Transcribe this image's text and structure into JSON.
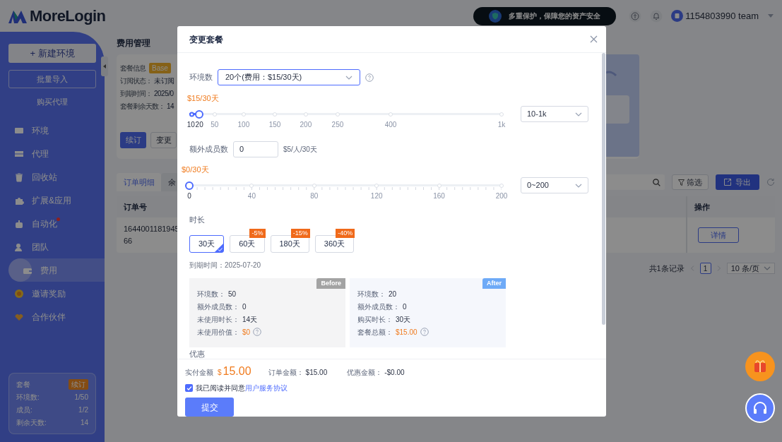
{
  "header": {
    "logo": "MoreLogin",
    "banner": "多重保护，保障您的资产安全",
    "account": "1154803990 team"
  },
  "sidebar": {
    "new_button": "+ 新建环境",
    "import_button": "批量导入",
    "proxy_link": "购买代理",
    "items": [
      {
        "label": "环境",
        "selected": false,
        "dot": false
      },
      {
        "label": "代理",
        "selected": false,
        "dot": false
      },
      {
        "label": "回收站",
        "selected": false,
        "dot": false
      },
      {
        "label": "扩展&应用",
        "selected": false,
        "dot": false
      },
      {
        "label": "自动化",
        "selected": false,
        "dot": true
      },
      {
        "label": "团队",
        "selected": false,
        "dot": false
      },
      {
        "label": "费用",
        "selected": true,
        "dot": false
      },
      {
        "label": "邀请奖励",
        "selected": false,
        "dot": false
      },
      {
        "label": "合作伙伴",
        "selected": false,
        "dot": false
      }
    ],
    "plan_card": {
      "title": "套餐",
      "renew": "续订",
      "rows": [
        {
          "label": "环境数:",
          "value": "1/50"
        },
        {
          "label": "成员:",
          "value": "1/2"
        },
        {
          "label": "剩余天数:",
          "value": "14"
        }
      ]
    }
  },
  "page": {
    "title": "费用管理",
    "plan": {
      "title": "套餐信息",
      "badge": "Base",
      "rows": [
        {
          "label": "订阅状态：",
          "value": "未订阅"
        },
        {
          "label": "到期时间：",
          "value": "2025/0"
        },
        {
          "label": "套餐剩余天数：",
          "value": "14"
        }
      ],
      "renew_button": "续订",
      "change_button": "变更"
    },
    "tabs": [
      {
        "label": "订单明细",
        "selected": true
      },
      {
        "label": "余",
        "selected": false
      }
    ],
    "filter_button": "筛选",
    "export_button": "导出",
    "table": {
      "columns": [
        "订单号",
        "操作"
      ],
      "rows": [
        {
          "order": [
            "1644001181945",
            "66"
          ],
          "action": "详情"
        }
      ]
    },
    "pagination": {
      "total": "共1条记录",
      "page": "1",
      "page_size": "10 条/页"
    }
  },
  "modal": {
    "title": "变更套餐",
    "env": {
      "label": "环境数",
      "value": "20个(费用：$15/30天)",
      "price": "$15/30天",
      "level": 0.032,
      "marks": [
        "10",
        "20",
        "50",
        "100",
        "150",
        "200",
        "250",
        "400",
        "1k"
      ],
      "range": "10-1k"
    },
    "members": {
      "label": "额外成员数",
      "value": "0",
      "unit": "$5/人/30天",
      "price": "$0/30天",
      "level": 0,
      "marks": [
        "0",
        "40",
        "80",
        "120",
        "160",
        "200"
      ],
      "range": "0~200"
    },
    "duration": {
      "label": "时长",
      "options": [
        {
          "label": "30天",
          "selected": true
        },
        {
          "label": "60天",
          "selected": false,
          "discount": "-5%"
        },
        {
          "label": "180天",
          "selected": false,
          "discount": "-15%"
        },
        {
          "label": "360天",
          "selected": false,
          "discount": "-40%"
        }
      ],
      "expiry": "到期时间：2025-07-20"
    },
    "panels": [
      {
        "kind": "before",
        "tag": "Before",
        "rows": [
          {
            "label": "环境数：",
            "value": "50",
            "highlight": false,
            "help": false
          },
          {
            "label": "额外成员数：",
            "value": "0",
            "highlight": false,
            "help": false
          },
          {
            "label": "未使用时长：",
            "value": "14天",
            "highlight": false,
            "help": false
          },
          {
            "label": "未使用价值：",
            "value": "$0",
            "highlight": true,
            "help": true
          }
        ]
      },
      {
        "kind": "after",
        "tag": "After",
        "rows": [
          {
            "label": "环境数：",
            "value": "20",
            "highlight": false,
            "help": false
          },
          {
            "label": "额外成员数：",
            "value": "0",
            "highlight": false,
            "help": false
          },
          {
            "label": "购买时长：",
            "value": "30天",
            "highlight": false,
            "help": false
          },
          {
            "label": "套餐总额：",
            "value": "$15.00",
            "highlight": true,
            "help": true
          }
        ]
      }
    ],
    "discount_label": "优惠",
    "footer": {
      "paid_label": "实付金额",
      "currency": "$",
      "amount": "15.00",
      "order_label": "订单金额：",
      "order_value": "$15.00",
      "discount_label": "优惠金额：",
      "discount_value": "-$0.00",
      "agree_checked": true,
      "agree_text": "我已阅读并同意",
      "agree_link": "用户服务协议",
      "submit": "提交"
    }
  }
}
